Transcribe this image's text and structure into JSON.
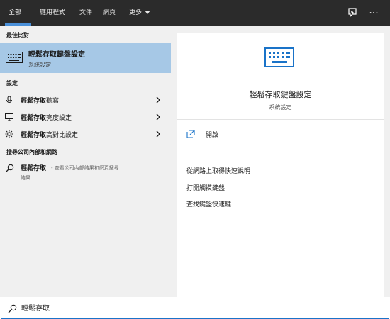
{
  "tabs": [
    {
      "label": "全部",
      "active": true
    },
    {
      "label": "應用程式"
    },
    {
      "label": "文件"
    },
    {
      "label": "網頁"
    },
    {
      "label": "更多"
    }
  ],
  "top_icons": [
    "feedback-icon",
    "more-options-icon"
  ],
  "more_icon_glyph": "···",
  "left": {
    "best_match_header": "最佳比對",
    "best_match": {
      "title": "輕鬆存取鍵盤設定",
      "subtitle": "系統設定",
      "icon": "keyboard-icon"
    },
    "settings_header": "設定",
    "settings_items": [
      {
        "bold": "輕鬆存取",
        "rest": "聽寫",
        "icon": "dictation-icon"
      },
      {
        "bold": "輕鬆存取",
        "rest": "亮度設定",
        "icon": "monitor-icon"
      },
      {
        "bold": "輕鬆存取",
        "rest": "高對比設定",
        "icon": "brightness-icon"
      }
    ],
    "web_header": "搜尋公司內部和網路",
    "web_item": {
      "main": "輕鬆存取",
      "sub_a": "- 查看公司內部結果和網頁搜尋",
      "sub_b": "結果",
      "icon": "search-icon"
    }
  },
  "right": {
    "title": "輕鬆存取鍵盤設定",
    "subtitle": "系統設定",
    "open_label": "開啟",
    "links": [
      "從網路上取得快速說明",
      "打開觸摸鍵盤",
      "查找鍵盤快速鍵"
    ]
  },
  "search": {
    "value": "輕鬆存取",
    "placeholder": ""
  },
  "colors": {
    "topbar": "#2b2b2b",
    "accent": "#4a90d9",
    "selection": "#a6c8e6",
    "search_border": "#1a73c8"
  }
}
